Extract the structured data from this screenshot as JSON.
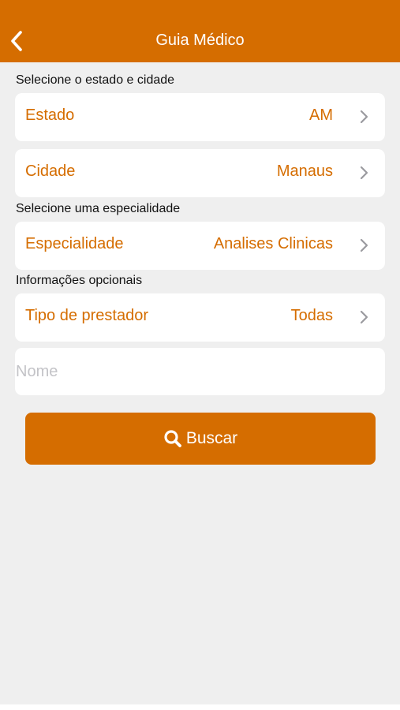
{
  "colors": {
    "accent": "#d56d00",
    "background": "#efefef",
    "card": "#ffffff"
  },
  "navbar": {
    "title": "Guia Médico",
    "back_icon": "chevron-left-icon"
  },
  "sections": {
    "state_city": "Selecione o estado e cidade",
    "specialty": "Selecione uma especialidade",
    "optional": "Informações opcionais"
  },
  "rows": {
    "estado": {
      "label": "Estado",
      "value": "AM",
      "icon": "chevron-right-icon"
    },
    "cidade": {
      "label": "Cidade",
      "value": "Manaus",
      "icon": "chevron-right-icon"
    },
    "especialidade": {
      "label": "Especialidade",
      "value": "Analises Clinicas",
      "icon": "chevron-right-icon"
    },
    "tipo_prestador": {
      "label": "Tipo de prestador",
      "value": "Todas",
      "icon": "chevron-right-icon"
    }
  },
  "name_input": {
    "placeholder": "Nome",
    "value": ""
  },
  "search_button": {
    "label": "Buscar",
    "icon": "search-icon"
  }
}
